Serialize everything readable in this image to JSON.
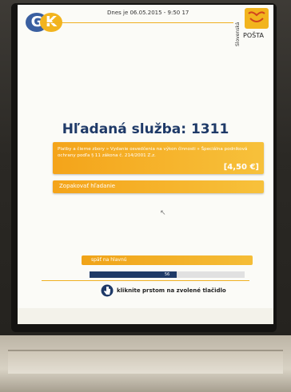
{
  "header": {
    "logo_text_1": "G",
    "logo_text_2": "K",
    "datetime": "Dnes je 06.05.2015 - 9:50 17",
    "brand_vertical": "Slovenská",
    "brand_name": "POŠTA"
  },
  "main": {
    "title": "Hľadaná služba: 1311",
    "service": {
      "text": "Platby a čierne zbory » Vydanie osvedčenia na výkon činnosti » Špeciálna podniková ochrany podľa § 11 zákona č. 214/2001 Z.z.",
      "price": "[4,50 €]"
    },
    "repeat_label": "Zopakovať hľadanie"
  },
  "footer": {
    "back_label": "späť na hlavnú",
    "progress_value": 56,
    "progress_label": "56",
    "hint": "kliknite prstom na zvolené tlačidlo"
  },
  "colors": {
    "accent_orange": "#f4a41a",
    "navy": "#1f3a68",
    "brand_yellow": "#f2b41e"
  },
  "icons": [
    "hand-pointer-icon",
    "posta-logo-icon",
    "ek-logo-icon",
    "mouse-cursor-icon"
  ]
}
